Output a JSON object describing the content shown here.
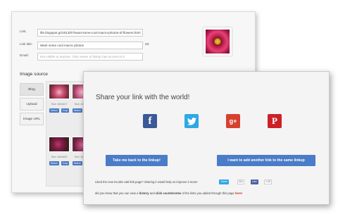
{
  "form": {
    "link_label": "Link:",
    "link_value": "ilfe.blogspot.gr/2013/07/want-some-cool-macro-photos-of-flowers.html",
    "title_label": "Link title:",
    "title_value": "Want some cool macro photos",
    "title_counter": "23",
    "email_label": "Email:",
    "email_placeholder": "Not visible to anyone. Only owner of linkup has access to it",
    "image_source_title": "Image source",
    "source_tabs": [
      "Blog",
      "Upload",
      "Image URL"
    ],
    "thumbnails": [
      {
        "size": "Size: 640x427",
        "select": "Select",
        "crop": "Crop"
      },
      {
        "size": "Size: 426x640",
        "select": "Select",
        "crop": "Crop"
      },
      {
        "size": "Size: 640x453",
        "select": "Select",
        "crop": "Crop"
      },
      {
        "size": "Size: 640x427",
        "select": "Select",
        "crop": "Crop"
      }
    ]
  },
  "share": {
    "title": "Share your link with the world!",
    "social_icons": [
      {
        "name": "facebook-icon",
        "glyph": "f",
        "color": "#3b5998"
      },
      {
        "name": "twitter-icon",
        "glyph": "t",
        "color": "#2fa8e5"
      },
      {
        "name": "google-plus-icon",
        "glyph": "g+",
        "color": "#d6412f"
      },
      {
        "name": "pinterest-icon",
        "glyph": "P",
        "color": "#cc2127"
      }
    ],
    "back_button": "Take me back to the linkup!",
    "another_button": "I want to add another link to the same linkup",
    "liked_text": "Liked the new InLinkz add link page? Sharing it would help us improve it more!",
    "tweet_label": "Tweet",
    "tweet_count": "324",
    "like_label": "Like",
    "like_count": "1.2K",
    "note_pre": "did you know that you can view a",
    "note_history": "history",
    "note_mid": "and",
    "note_counts": "click counts/votes",
    "note_post": "of the links you added through this page",
    "note_link": "here!"
  }
}
